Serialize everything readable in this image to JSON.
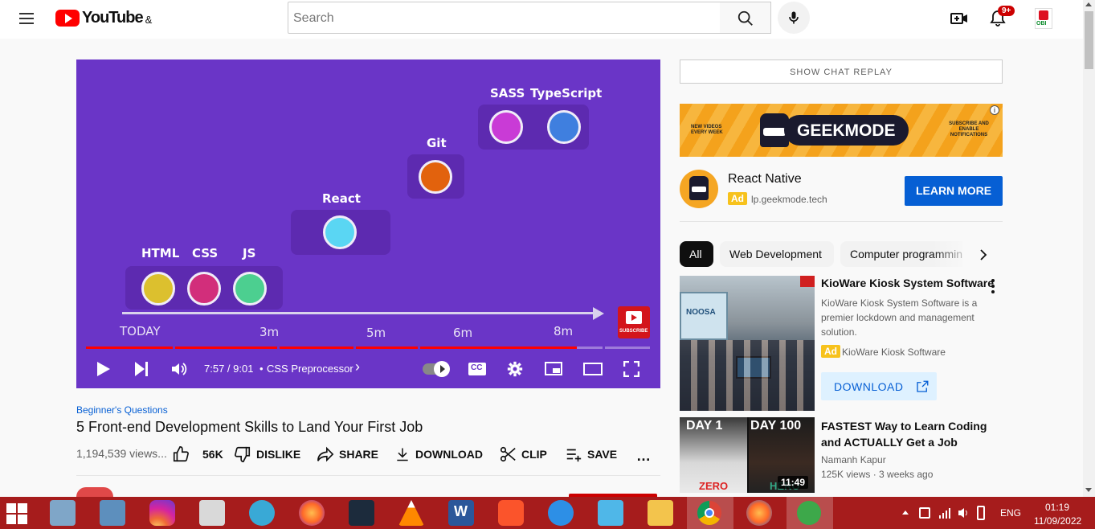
{
  "header": {
    "logo_text": "YouTube",
    "logo_suffix": "&",
    "search_placeholder": "Search",
    "notif_count": "9+",
    "avatar_text": "OBI"
  },
  "player": {
    "skills": {
      "html": "HTML",
      "css": "CSS",
      "js": "JS",
      "react": "React",
      "git": "Git",
      "sass": "SASS",
      "ts": "TypeScript"
    },
    "timeline": {
      "t0": "TODAY",
      "t1": "3m",
      "t2": "5m",
      "t3": "6m",
      "t4": "8m"
    },
    "subscribe_label": "SUBSCRIBE",
    "time": "7:57 / 9:01",
    "chapter": "CSS Preprocessor",
    "chapter_chevron": "›",
    "progress": 0.87
  },
  "video": {
    "hashtag": "Beginner's Questions",
    "title": "5 Front-end Development Skills to Land Your First Job",
    "views": "1,194,539 views...",
    "likes": "56K",
    "dislike": "DISLIKE",
    "share": "SHARE",
    "download": "DOWNLOAD",
    "clip": "CLIP",
    "save": "SAVE",
    "more": "…"
  },
  "sidebar": {
    "chat_replay": "SHOW CHAT REPLAY",
    "banner": {
      "brand": "GEEKMODE",
      "left_text": "NEW VIDEOS EVERY WEEK",
      "right_text": "SUBSCRIBE AND ENABLE NOTIFICATIONS"
    },
    "ad1": {
      "title": "React Native",
      "badge": "Ad",
      "domain": "lp.geekmode.tech",
      "cta": "LEARN MORE"
    },
    "chips": [
      "All",
      "Web Development",
      "Computer programming"
    ],
    "ad2": {
      "title": "KioWare Kiosk System Software",
      "desc": "KioWare Kiosk System Software is a premier lockdown and management solution.",
      "badge": "Ad",
      "advertiser": "KioWare Kiosk Software",
      "cta": "DOWNLOAD",
      "thumb_text": "NOOSA"
    },
    "video2": {
      "title": "FASTEST Way to Learn Coding and ACTUALLY Get a Job",
      "channel": "Namanh Kapur",
      "meta": "125K views · 3 weeks ago",
      "duration": "11:49",
      "thumb_left_top": "DAY 1",
      "thumb_right_top": "DAY 100",
      "thumb_left_bottom": "ZERO",
      "thumb_right_bottom": "HERO"
    }
  },
  "taskbar": {
    "lang": "ENG",
    "time": "01:19",
    "date": "11/09/2022"
  },
  "colors": {
    "accent_red": "#ff0000",
    "player_bg": "#6a35c7",
    "learn_more_blue": "#065fd4",
    "ad_badge": "#f7c21c",
    "taskbar": "#a61c1c"
  }
}
